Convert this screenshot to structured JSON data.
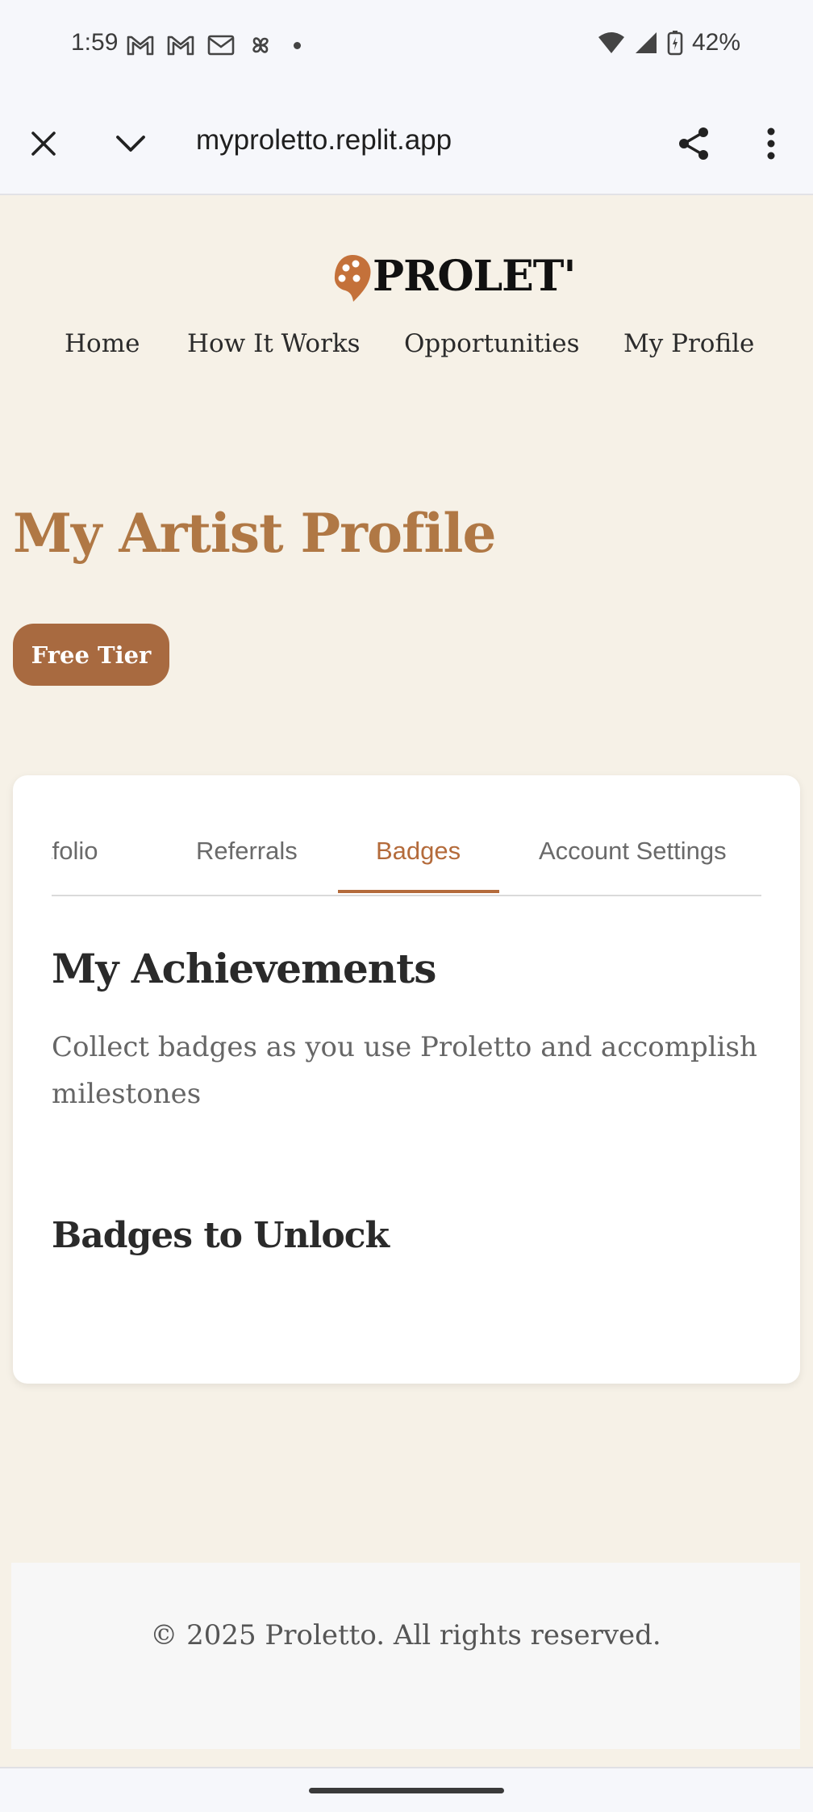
{
  "status_bar": {
    "time": "1:59",
    "battery": "42%",
    "notification_icons": [
      "gmail-icon",
      "gmail-icon",
      "mail-icon",
      "pinwheel-icon"
    ]
  },
  "browser": {
    "url": "myproletto.replit.app"
  },
  "site": {
    "logo_text": "PROLET'",
    "nav": [
      "Home",
      "How It Works",
      "Opportunities",
      "My Profile"
    ]
  },
  "profile": {
    "title": "My Artist Profile",
    "tier": "Free Tier"
  },
  "tabs": {
    "items": [
      "tfolio",
      "Referrals",
      "Badges",
      "Account Settings"
    ],
    "active": "Badges"
  },
  "achievements": {
    "title": "My Achievements",
    "description": "Collect badges as you use Proletto and accomplish milestones",
    "unlock_title": "Badges to Unlock"
  },
  "footer": {
    "text": "© 2025 Proletto. All rights reserved."
  },
  "colors": {
    "page_bg": "#f6f1e7",
    "accent": "#b46b3b",
    "title_brown": "#b07845",
    "badge_bg": "#a86a40"
  }
}
